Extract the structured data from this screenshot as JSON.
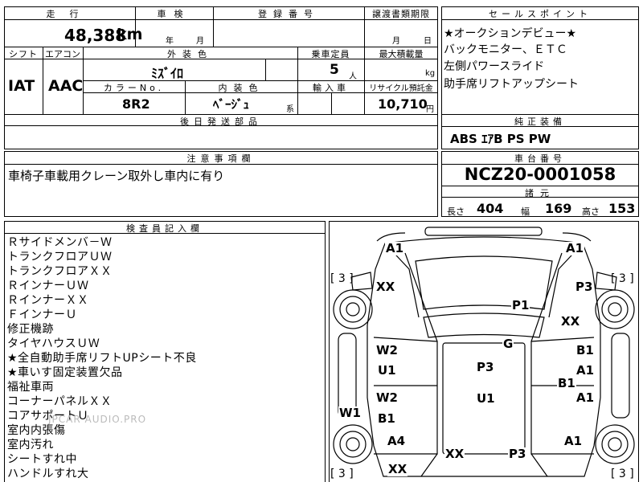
{
  "top": {
    "mileage_label": "走行",
    "mileage_value": "48,388",
    "mileage_unit": "km",
    "inspection_label": "車検",
    "inspection_year": "年",
    "inspection_month": "月",
    "registration_label": "登録番号",
    "transfer_label": "譲渡書類期限",
    "transfer_month": "月",
    "transfer_day": "日"
  },
  "row2": {
    "shift_label": "シフト",
    "aircon_label": "エアコン",
    "exterior_label": "外装色",
    "capacity_label": "乗車定員",
    "maxload_label": "最大積載量",
    "shift_value": "IAT",
    "aircon_value": "AAC",
    "exterior_value": "ﾐｽﾞｲﾛ",
    "capacity_value": "5",
    "capacity_unit": "人",
    "maxload_unit": "kg",
    "color_no_label": "カラーNo.",
    "interior_label": "内装色",
    "import_label": "輸入車",
    "recycle_label": "リサイクル預託金",
    "color_no_value": "8R2",
    "interior_value": "ﾍﾞｰｼﾞｭ",
    "interior_suffix": "系",
    "recycle_value": "10,710",
    "recycle_unit": "円",
    "parts_label": "後日発送部品"
  },
  "sales_points": {
    "label": "セールスポイント",
    "items": [
      "★オークションデビュー★",
      "バックモニター、ＥＴＣ",
      "左側パワースライド",
      "助手席リフトアップシート"
    ]
  },
  "equipment": {
    "label": "純正装備",
    "value": "ABS ｴｱB PS PW"
  },
  "caution": {
    "label": "注意事項欄",
    "value": "車椅子車載用クレーン取外し車内に有り"
  },
  "chassis": {
    "label": "車台番号",
    "value": "NCZ20-0001058",
    "spec_label": "諸元",
    "length_label": "長さ",
    "length_value": "404",
    "width_label": "幅",
    "width_value": "169",
    "height_label": "高さ",
    "height_value": "153"
  },
  "inspector": {
    "label": "検査員記入欄",
    "lines": [
      "Ｒサイドメンバ－Ｗ",
      "トランクフロアＵＷ",
      "トランクフロアＸＸ",
      "ＲインナーＵＷ",
      "ＲインナーＸＸ",
      "ＦインナーＵ",
      "修正機跡",
      "タイヤハウスＵＷ",
      "★全自動助手席リフトUPシート不良",
      "★車いす固定装置欠品",
      "福祉車両",
      "コーナーパネルＸＸ",
      "コアサポートＵ",
      "室内内張傷",
      "室内汚れ",
      "シートすれ中",
      "ハンドルすれ大"
    ]
  },
  "diagram": {
    "tire_left_top": "[ 3 ]",
    "tire_right_top": "[ 3 ]",
    "tire_left_bottom": "[ 3 ]",
    "tire_right_bottom": "[ 3 ]",
    "marks": [
      "A1",
      "A1",
      "XX",
      "P3",
      "P1",
      "XX",
      "G",
      "W2",
      "B1",
      "U1",
      "P3",
      "A1",
      "B1",
      "W2",
      "U1",
      "A1",
      "W1",
      "B1",
      "A4",
      "A1",
      "XX",
      "P3",
      "XX"
    ]
  },
  "watermark": "JPCAR AUDIO.PRO"
}
